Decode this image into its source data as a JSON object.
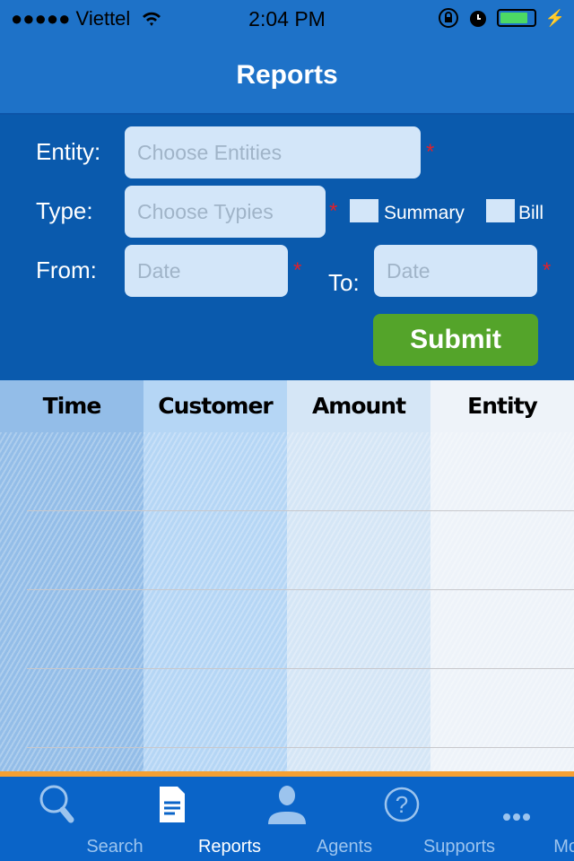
{
  "status": {
    "carrier": "●●●●● Viettel",
    "time": "2:04 PM",
    "battery_level": 0.85
  },
  "nav": {
    "title": "Reports"
  },
  "form": {
    "entity_label": "Entity:",
    "entity_placeholder": "Choose Entities",
    "type_label": "Type:",
    "type_placeholder": "Choose Typies",
    "summary_label": "Summary",
    "bill_label": "Bill",
    "from_label": "From:",
    "from_placeholder": "Date",
    "to_label": "To:",
    "to_placeholder": "Date",
    "required_mark": "*",
    "submit_label": "Submit"
  },
  "table": {
    "columns": [
      {
        "label": "Time",
        "color": "#93bde8"
      },
      {
        "label": "Customer",
        "color": "#b5d6f5"
      },
      {
        "label": "Amount",
        "color": "#d5e6f6"
      },
      {
        "label": "Entity",
        "color": "#eef3f9"
      }
    ]
  },
  "tabs": [
    {
      "label": "Search",
      "icon": "search-icon"
    },
    {
      "label": "Reports",
      "icon": "document-icon",
      "active": true
    },
    {
      "label": "Agents",
      "icon": "person-icon"
    },
    {
      "label": "Supports",
      "icon": "question-icon"
    },
    {
      "label": "More",
      "icon": "more-icon"
    }
  ]
}
